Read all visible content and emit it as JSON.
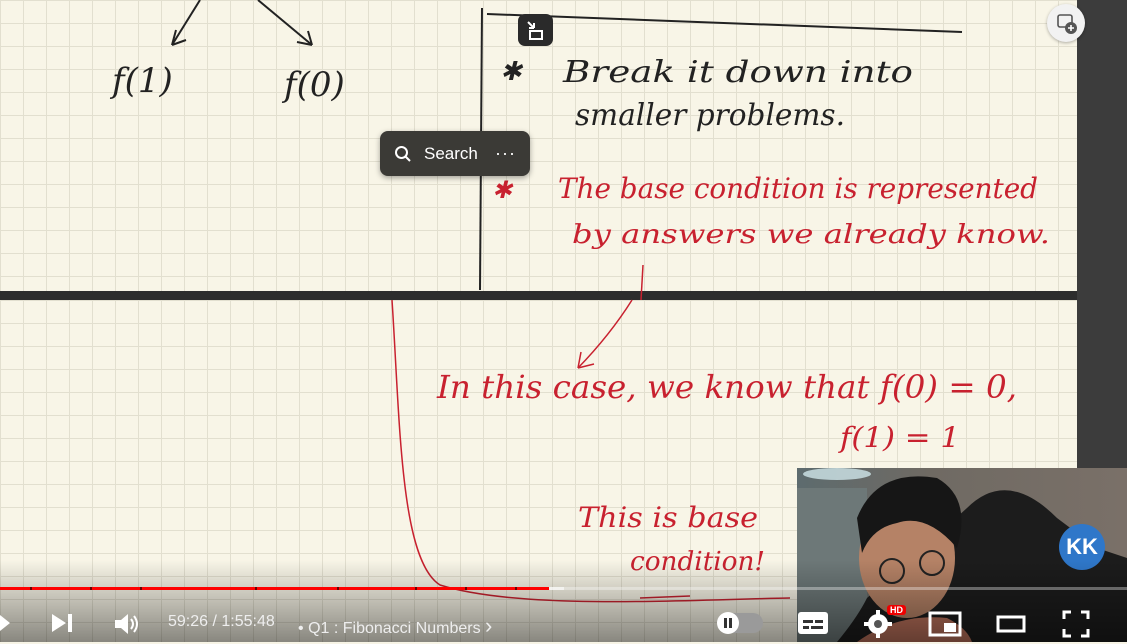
{
  "board": {
    "top_left_labels": [
      "f(1)",
      "f(0)"
    ],
    "note_line1": "Break it down into",
    "note_line2": "smaller problems.",
    "base_line1": "The base condition is represented",
    "base_line2": "by answers we already know.",
    "case_line1": "In this case, we know that f(0) = 0,",
    "case_line2": "f(1) = 1",
    "base_label1": "This is base",
    "base_label2": "condition!"
  },
  "search_popup": {
    "label": "Search",
    "more": "···",
    "icon": "search-icon"
  },
  "player": {
    "time": "59:26 / 1:55:48",
    "chapter_separator": "•",
    "chapter": "Q1 : Fibonacci Numbers",
    "chapter_chevron": "›",
    "hd_badge": "HD",
    "progress_played_fraction": 0.487,
    "progress_buffered_fraction": 0.5,
    "accent_color": "#ff0000",
    "icons": [
      "play-icon",
      "next-icon",
      "volume-icon",
      "autoplay-toggle",
      "subtitles-icon",
      "settings-icon",
      "miniplayer-icon",
      "theater-icon",
      "fullscreen-icon"
    ]
  },
  "pip": {
    "channel_logo": "KK"
  }
}
